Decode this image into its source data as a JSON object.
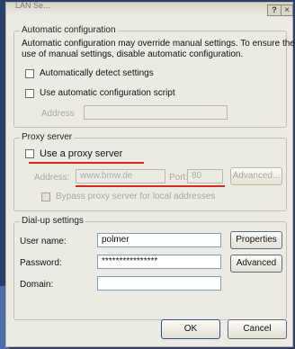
{
  "titlebar": {
    "title": "LAN Se...",
    "help": "?",
    "close": "×"
  },
  "auto": {
    "legend": "Automatic configuration",
    "desc_line1": "Automatic configuration may override manual settings.  To ensure the",
    "desc_line2": "use of manual settings, disable automatic configuration.",
    "detect_label": "Automatically detect settings",
    "script_label": "Use automatic configuration script",
    "address_label": "Address",
    "address_value": ""
  },
  "proxy": {
    "legend": "Proxy server",
    "use_label": "Use a proxy server",
    "address_label": "Address:",
    "address_value": "www.bmw.de",
    "port_label": "Port:",
    "port_value": "80",
    "advanced_label": "Advanced...",
    "bypass_label": "Bypass proxy server for local addresses"
  },
  "dialup": {
    "legend": "Dial-up settings",
    "user_label": "User name:",
    "user_value": "polmer",
    "password_label": "Password:",
    "password_value": "****************",
    "domain_label": "Domain:",
    "domain_value": "",
    "properties_label": "Properties",
    "advanced_label": "Advanced"
  },
  "footer": {
    "ok_label": "OK",
    "cancel_label": "Cancel"
  },
  "colors": {
    "annotation": "#d42a20",
    "dialog_bg": "#ecebe3"
  }
}
